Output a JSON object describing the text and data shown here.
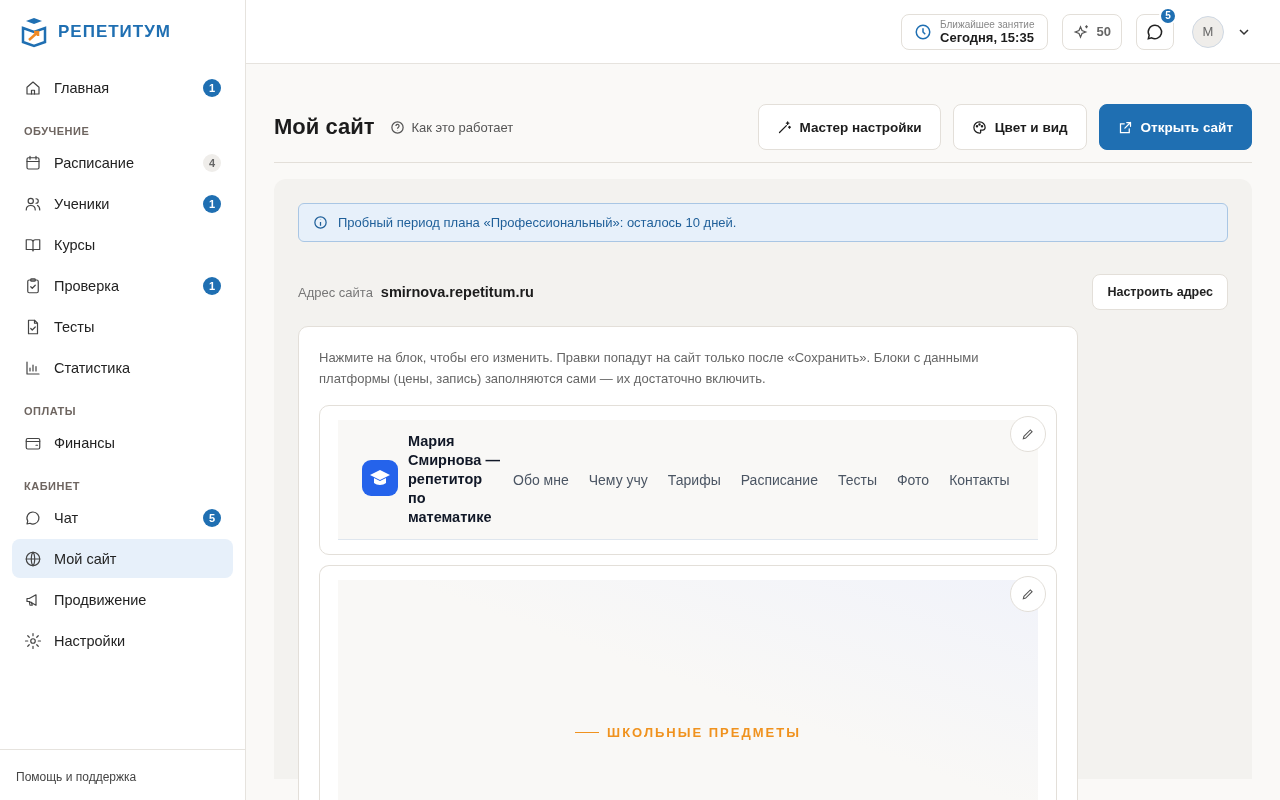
{
  "brand": {
    "name": "РЕПЕТИТУМ"
  },
  "sidebar": {
    "sections": [
      {
        "items": [
          {
            "label": "Главная",
            "badge": "1",
            "muted": false,
            "selected": false
          }
        ]
      },
      {
        "title": "ОБУЧЕНИЕ",
        "items": [
          {
            "label": "Расписание",
            "badge": "4",
            "muted": true,
            "selected": false
          },
          {
            "label": "Ученики",
            "badge": "1",
            "muted": false,
            "selected": false
          },
          {
            "label": "Курсы",
            "selected": false
          },
          {
            "label": "Проверка",
            "badge": "1",
            "muted": false,
            "selected": false
          },
          {
            "label": "Тесты",
            "selected": false
          },
          {
            "label": "Статистика",
            "selected": false
          }
        ]
      },
      {
        "title": "ОПЛАТЫ",
        "items": [
          {
            "label": "Финансы",
            "selected": false
          }
        ]
      },
      {
        "title": "КАБИНЕТ",
        "items": [
          {
            "label": "Чат",
            "badge": "5",
            "muted": false,
            "selected": false
          },
          {
            "label": "Мой сайт",
            "selected": true
          },
          {
            "label": "Продвижение",
            "selected": false
          },
          {
            "label": "Настройки",
            "selected": false
          }
        ]
      }
    ],
    "footer": "Помощь и поддержка"
  },
  "topbar": {
    "next_lesson": {
      "label": "Ближайшее занятие",
      "value": "Сегодня, 15:35"
    },
    "points": "50",
    "chat_badge": "5",
    "avatar": "М"
  },
  "page": {
    "title": "Мой сайт",
    "help_link": "Как это работает",
    "actions": [
      {
        "label": "Мастер настройки",
        "primary": false
      },
      {
        "label": "Цвет и вид",
        "primary": false
      },
      {
        "label": "Открыть сайт",
        "primary": true
      }
    ]
  },
  "notice": "Пробный период плана «Профессиональный»: осталось 10 дней.",
  "address": {
    "label": "Адрес сайта",
    "value": "smirnova.repetitum.ru",
    "button": "Настроить адрес"
  },
  "editor": {
    "hint": "Нажмите на блок, чтобы его изменить. Правки попадут на сайт только после «Сохранить». Блоки с данными платформы (цены, запись) заполняются сами — их достаточно включить.",
    "header_block": {
      "site_title": "Мария Смирнова — репетитор по математике",
      "menu": [
        "Обо мне",
        "Чему учу",
        "Тарифы",
        "Расписание",
        "Тесты",
        "Фото",
        "Контакты"
      ]
    },
    "hero_block": {
      "eyebrow": "ШКОЛЬНЫЕ ПРЕДМЕТЫ"
    }
  }
}
